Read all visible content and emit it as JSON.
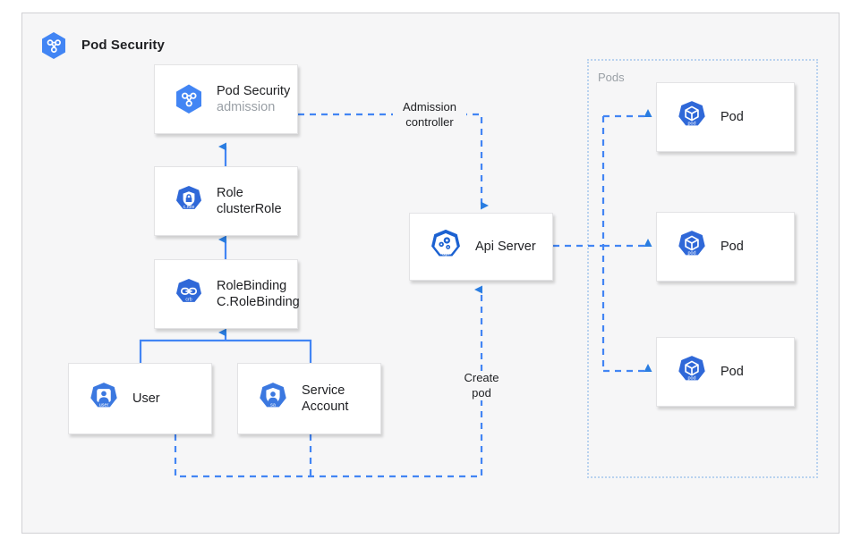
{
  "header": {
    "title": "Pod Security",
    "icon": "k8s-pod-security-hexagon-icon"
  },
  "colors": {
    "accent_blue": "#4285f4",
    "icon_blue": "#3367d6",
    "canvas_bg": "#f6f6f7",
    "frame_border": "#d0d0d4",
    "node_bg": "#ffffff",
    "node_border": "#e3e3e5",
    "muted_text": "#9aa0a6",
    "dotted_group_border": "#b9d2ef",
    "text": "#202124"
  },
  "nodes": {
    "pod_security_admission": {
      "line1": "Pod Security",
      "line2": "admission",
      "icon": "pod-security-hexagon-icon",
      "icon_badge": ""
    },
    "role": {
      "line1": "Role",
      "line2": "clusterRole",
      "icon": "role-lock-icon",
      "icon_badge": "c.role"
    },
    "rolebinding": {
      "line1": "RoleBinding",
      "line2": "C.RoleBinding",
      "icon": "rolebinding-link-icon",
      "icon_badge": "crb"
    },
    "user": {
      "line1": "User",
      "line2": "",
      "icon": "user-icon",
      "icon_badge": "user"
    },
    "service_account": {
      "line1": "Service",
      "line2": "Account",
      "icon": "service-account-shield-icon",
      "icon_badge": "sa"
    },
    "api_server": {
      "line1": "Api Server",
      "line2": "",
      "icon": "api-server-gears-icon",
      "icon_badge": "api"
    }
  },
  "pods_group": {
    "label": "Pods",
    "pods": [
      {
        "label": "Pod",
        "icon": "pod-cube-icon",
        "icon_badge": "pod"
      },
      {
        "label": "Pod",
        "icon": "pod-cube-icon",
        "icon_badge": "pod"
      },
      {
        "label": "Pod",
        "icon": "pod-cube-icon",
        "icon_badge": "pod"
      }
    ]
  },
  "edge_labels": {
    "admission_controller_l1": "Admission",
    "admission_controller_l2": "controller",
    "create_pod_l1": "Create",
    "create_pod_l2": "pod"
  }
}
